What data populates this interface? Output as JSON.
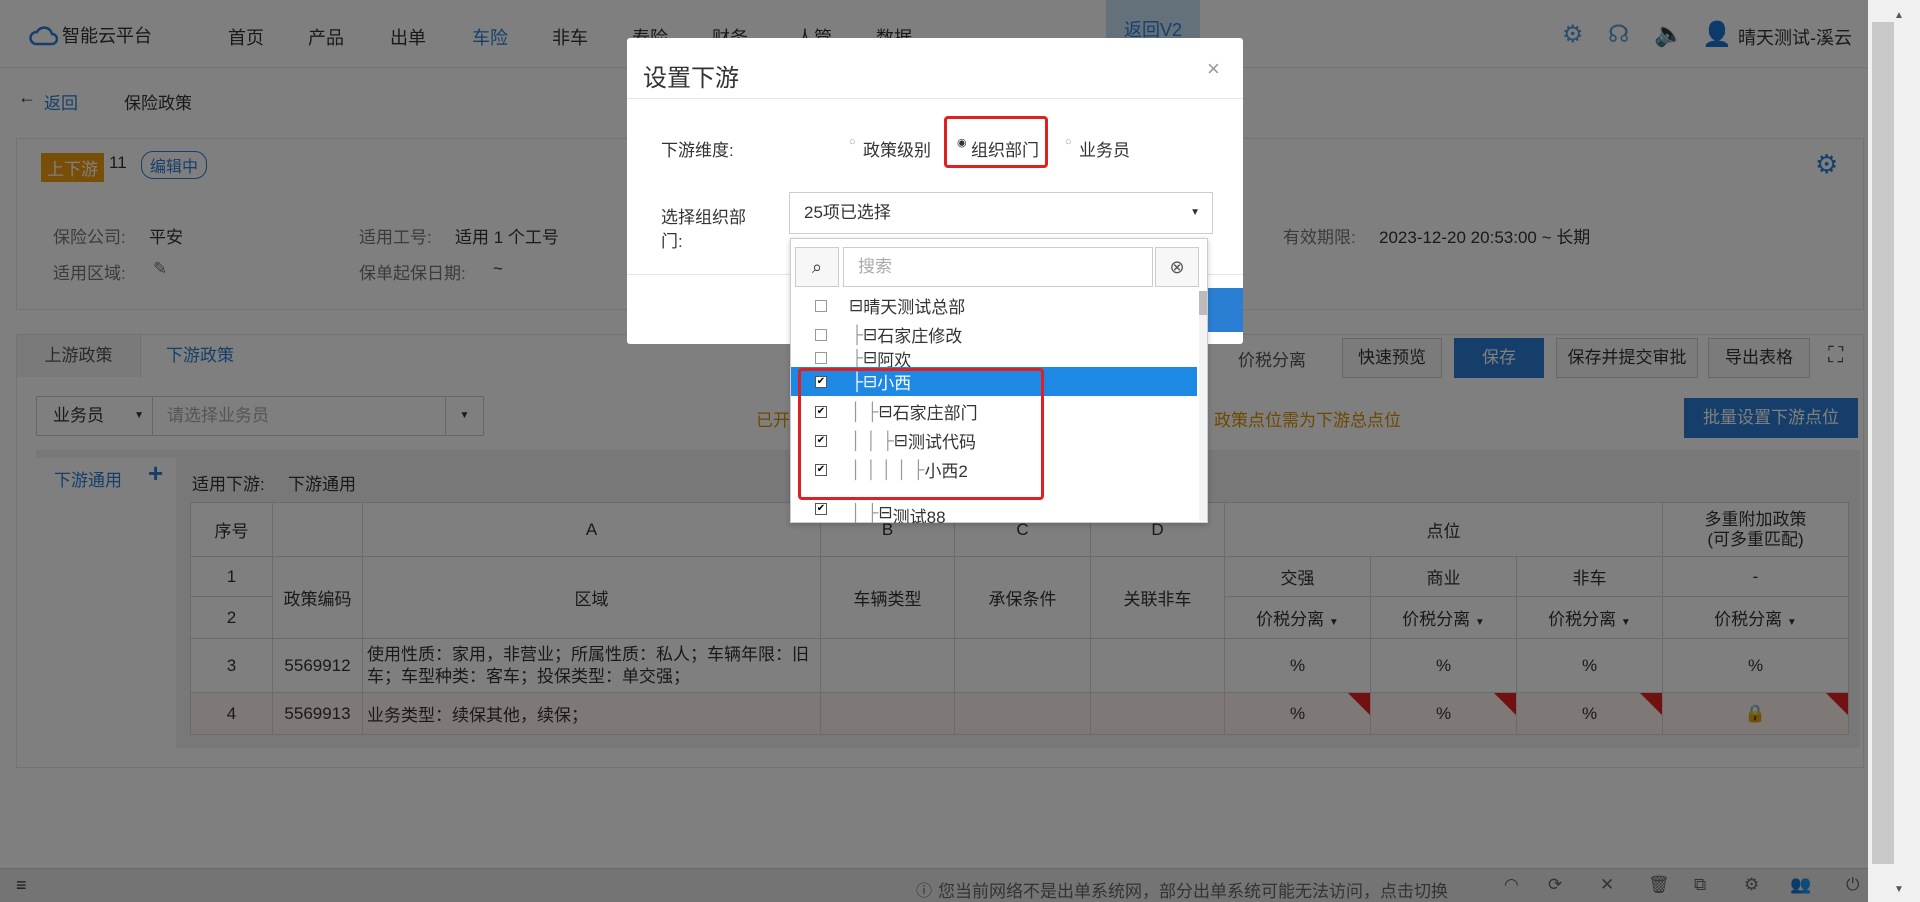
{
  "app": {
    "title": "智能云平台",
    "user": "晴天测试-溪云"
  },
  "nav": [
    "首页",
    "产品",
    "出单",
    "车险",
    "非车",
    "寿险",
    "财务",
    "人管",
    "数据"
  ],
  "fanhui_tab": "返回V2",
  "breadcrumb": {
    "back": "返回",
    "page": "保险政策"
  },
  "policy": {
    "tag": "上下游",
    "count": "11",
    "status": "编辑中",
    "company_label": "保险公司:",
    "company": "平安",
    "worknum_label": "适用工号:",
    "worknum": "适用 1 个工号",
    "region_label": "适用区域:",
    "startdate_label": "保单起保日期:",
    "startdate": "~",
    "validity_label": "有效期限:",
    "validity": "2023-12-20 20:53:00 ~ 长期"
  },
  "tabs": [
    "上游政策",
    "下游政策"
  ],
  "toolbar": {
    "tax": "价税分离",
    "preview": "快速预览",
    "save": "保存",
    "save_submit": "保存并提交审批",
    "export": "导出表格",
    "batch": "批量设置下游点位"
  },
  "filter": {
    "select": "业务员",
    "placeholder": "请选择业务员",
    "notice_left": "已开",
    "notice_right": "政策点位需为下游总点位"
  },
  "downstream": {
    "link": "下游通用",
    "applies_label": "适用下游:",
    "applies_value": "下游通用"
  },
  "grid": {
    "head": {
      "seq": "序号",
      "A": "A",
      "B": "B",
      "C": "C",
      "D": "D",
      "points": "点位",
      "multi1": "多重附加政策",
      "multi2": "(可多重匹配)"
    },
    "sub": {
      "code": "政策编码",
      "region": "区域",
      "vehicle": "车辆类型",
      "cond": "承保条件",
      "link": "关联非车",
      "jq": "交强",
      "sy": "商业",
      "fc": "非车",
      "dash": "-",
      "tax": "价税分离"
    },
    "rows": [
      {
        "seq": "1"
      },
      {
        "seq": "2"
      },
      {
        "seq": "3",
        "code": "5569912",
        "region": "使用性质：家用，非营业；所属性质：私人；车辆年限：旧车；车型种类：客车；投保类型：单交强；",
        "p1": "%",
        "p2": "%",
        "p3": "%",
        "p4": "%"
      },
      {
        "seq": "4",
        "code": "5569913",
        "region": "业务类型：续保其他，续保；",
        "p1": "%",
        "p2": "%",
        "p3": "%"
      }
    ]
  },
  "modal": {
    "title": "设置下游",
    "close": "×",
    "dim_label": "下游维度:",
    "opt1": "政策级别",
    "opt2": "组织部门",
    "opt3": "业务员",
    "org_label": "选择组织部门:",
    "org_value": "25项已选择",
    "search_placeholder": "搜索",
    "tree": [
      "晴天测试总部",
      "石家庄修改",
      "阿欢",
      "小西",
      "石家庄部门",
      "测试代码",
      "小西2",
      "测试88"
    ]
  },
  "status": {
    "notice": "您当前网络不是出单系统网，部分出单系统可能无法访问，点击切换"
  },
  "colors": {
    "accent": "#2a7fd4",
    "orange": "#f39c12",
    "red": "#e02020"
  }
}
